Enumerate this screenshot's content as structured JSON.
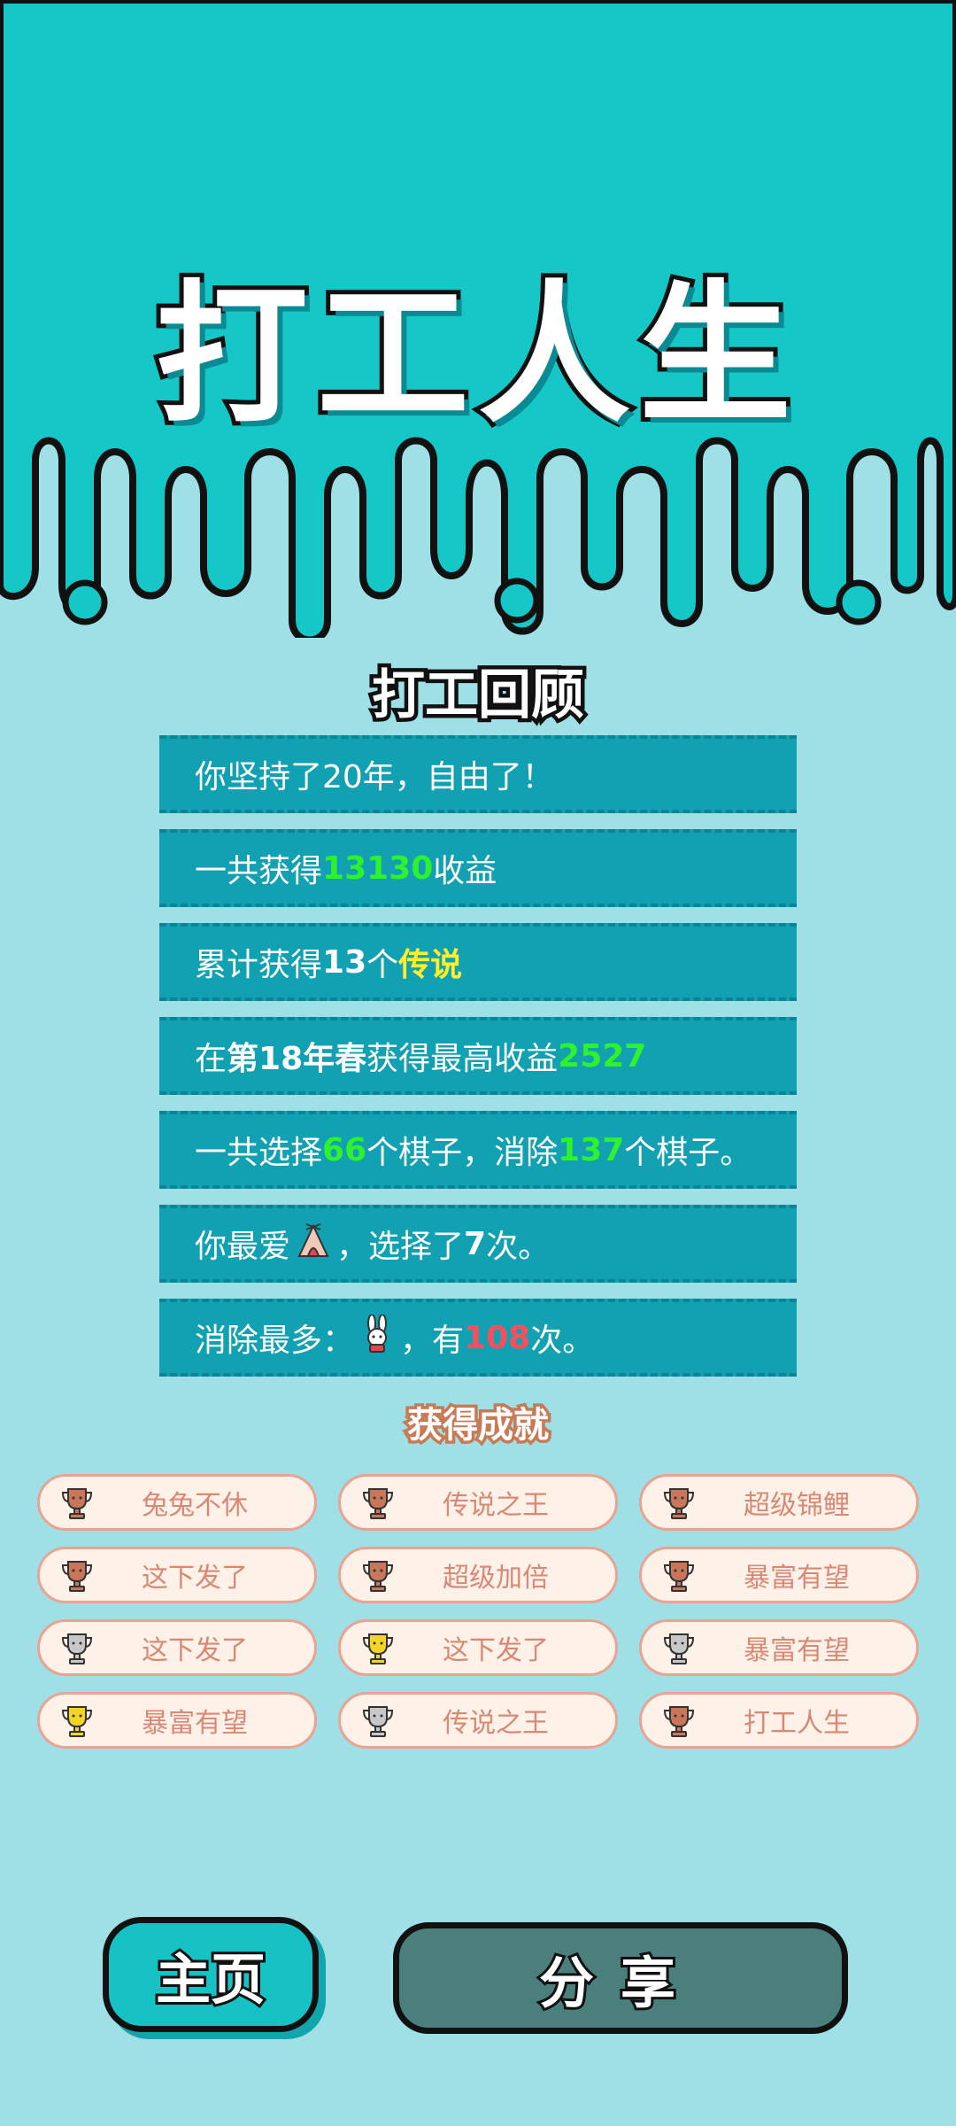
{
  "app": {
    "title": "打工人生"
  },
  "review": {
    "title": "打工回顾",
    "rows": [
      {
        "parts": [
          {
            "text": "你坚持了20年，自由了！"
          }
        ]
      },
      {
        "parts": [
          {
            "text": "一共获得"
          },
          {
            "text": "13130",
            "cls": "green hl"
          },
          {
            "text": "收益"
          }
        ]
      },
      {
        "parts": [
          {
            "text": "累计获得"
          },
          {
            "text": "13",
            "cls": "hl"
          },
          {
            "text": "个"
          },
          {
            "text": "传说",
            "cls": "yellow hl"
          }
        ]
      },
      {
        "parts": [
          {
            "text": "在 "
          },
          {
            "text": "第18年春",
            "cls": "hl"
          },
          {
            "text": " 获得最高收益"
          },
          {
            "text": "2527",
            "cls": "green hl"
          }
        ]
      },
      {
        "parts": [
          {
            "text": "一共选择"
          },
          {
            "text": "66",
            "cls": "green hl"
          },
          {
            "text": "个棋子，消除"
          },
          {
            "text": "137",
            "cls": "green hl"
          },
          {
            "text": "个棋子。"
          }
        ]
      },
      {
        "parts": [
          {
            "text": "你最爱"
          },
          {
            "icon": "tent-icon"
          },
          {
            "text": "，选择了"
          },
          {
            "text": "7",
            "cls": "hl"
          },
          {
            "text": "次。"
          }
        ]
      },
      {
        "parts": [
          {
            "text": "消除最多："
          },
          {
            "icon": "rabbit-icon"
          },
          {
            "text": "，有"
          },
          {
            "text": "108",
            "cls": "red hl"
          },
          {
            "text": "次。"
          }
        ]
      }
    ]
  },
  "achievements": {
    "title": "获得成就",
    "items": [
      {
        "label": "兔兔不休",
        "trophy": "bronze"
      },
      {
        "label": "传说之王",
        "trophy": "bronze"
      },
      {
        "label": "超级锦鲤",
        "trophy": "bronze"
      },
      {
        "label": "这下发了",
        "trophy": "bronze"
      },
      {
        "label": "超级加倍",
        "trophy": "bronze"
      },
      {
        "label": "暴富有望",
        "trophy": "bronze"
      },
      {
        "label": "这下发了",
        "trophy": "silver"
      },
      {
        "label": "这下发了",
        "trophy": "gold"
      },
      {
        "label": "暴富有望",
        "trophy": "silver"
      },
      {
        "label": "暴富有望",
        "trophy": "gold"
      },
      {
        "label": "传说之王",
        "trophy": "silver"
      },
      {
        "label": "打工人生",
        "trophy": "bronze"
      }
    ]
  },
  "buttons": {
    "home": "主页",
    "share": "分享"
  },
  "colors": {
    "top_bg": "#16c7c7",
    "page_bg": "#9fdfe6",
    "row_bg": "#11a1b2",
    "bronze": "#c9765a",
    "silver": "#c8c8c8",
    "gold": "#f3d42a"
  }
}
